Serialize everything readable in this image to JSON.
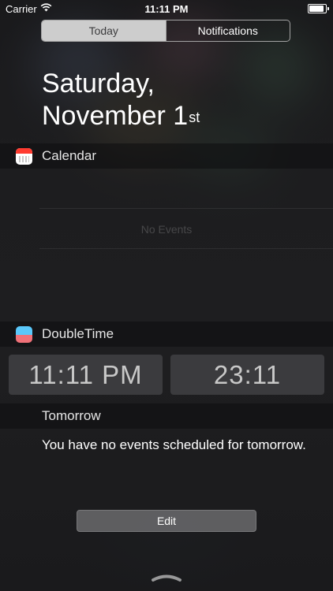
{
  "status_bar": {
    "carrier": "Carrier",
    "time": "11:11 PM",
    "battery_level": 0.9
  },
  "segmented_control": {
    "tabs": [
      "Today",
      "Notifications"
    ],
    "selected": "Today"
  },
  "date": {
    "line1": "Saturday,",
    "line2": "November 1",
    "suffix": "st"
  },
  "widgets": {
    "calendar": {
      "title": "Calendar",
      "empty_text": "No Events",
      "icon": "calendar-icon"
    },
    "doubletime": {
      "title": "DoubleTime",
      "icon": "doubletime-icon",
      "time_12h": "11:11 PM",
      "time_24h": "23:11",
      "section_title": "Tomorrow",
      "message": "You have no events scheduled for tomorrow."
    }
  },
  "edit_label": "Edit",
  "icons": {
    "wifi": "wifi-icon",
    "battery": "battery-icon",
    "handle": "chevron-up-icon"
  },
  "colors": {
    "active_tab_bg": "#cdcdcd",
    "calendar_red": "#ff3b30",
    "doubletime_blue": "#5ac8fa",
    "doubletime_pink": "#f07178"
  }
}
